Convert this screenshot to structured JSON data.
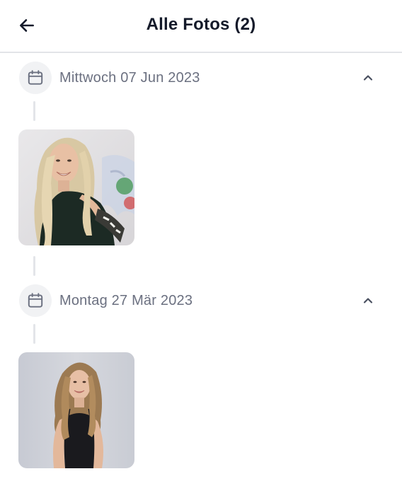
{
  "header": {
    "title": "Alle Fotos (2)",
    "back_icon": "arrow-left-icon"
  },
  "groups": [
    {
      "date": "Mittwoch 07 Jun 2023",
      "calendar_icon": "calendar-icon",
      "collapse_icon": "chevron-up-icon",
      "photos": [
        {
          "alt": "Foto"
        }
      ]
    },
    {
      "date": "Montag 27 Mär 2023",
      "calendar_icon": "calendar-icon",
      "collapse_icon": "chevron-up-icon",
      "photos": [
        {
          "alt": "Foto"
        }
      ]
    }
  ],
  "colors": {
    "text_primary": "#141a2a",
    "text_secondary": "#6b7080",
    "divider": "#e2e4e8",
    "icon_bg": "#f1f2f4"
  }
}
